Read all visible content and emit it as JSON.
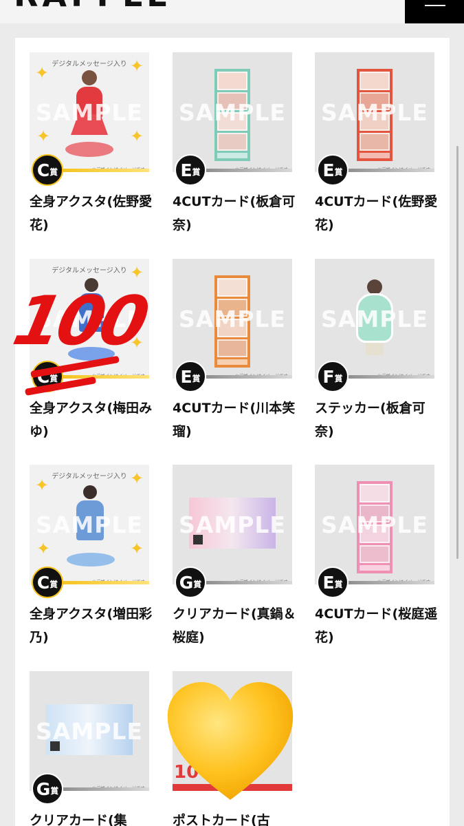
{
  "header": {
    "logo_text": "RAFFLE",
    "menu_icon": "hamburger-icon"
  },
  "products": [
    {
      "title": "全身アクスタ(佐野愛花)",
      "prize_letter": "C",
      "prize_kanji": "賞",
      "type": "stand",
      "tag": "デジタルメッセージ入り",
      "watermark": "SAMPLE",
      "note": "※デザインはイメージです"
    },
    {
      "title": "4CUTカード(板倉可奈)",
      "prize_letter": "E",
      "prize_kanji": "賞",
      "type": "strip",
      "watermark": "SAMPLE",
      "note": "※デザインはイメージです"
    },
    {
      "title": "4CUTカード(佐野愛花)",
      "prize_letter": "E",
      "prize_kanji": "賞",
      "type": "strip",
      "watermark": "SAMPLE",
      "note": "※デザインはイメージです"
    },
    {
      "title": "全身アクスタ(梅田みゆ)",
      "prize_letter": "C",
      "prize_kanji": "賞",
      "type": "stand",
      "tag": "デジタルメッセージ入り",
      "watermark": "SAMPLE",
      "note": "※デザインはイメージです"
    },
    {
      "title": "4CUTカード(川本笑瑠)",
      "prize_letter": "E",
      "prize_kanji": "賞",
      "type": "strip",
      "watermark": "SAMPLE",
      "note": "※デザインはイメージです"
    },
    {
      "title": "ステッカー(板倉可奈)",
      "prize_letter": "F",
      "prize_kanji": "賞",
      "type": "sticker",
      "watermark": "SAMPLE",
      "note": "※デザインはイメージです"
    },
    {
      "title": "全身アクスタ(増田彩乃)",
      "prize_letter": "C",
      "prize_kanji": "賞",
      "type": "stand",
      "tag": "デジタルメッセージ入り",
      "watermark": "SAMPLE",
      "note": "※デザインはイメージです"
    },
    {
      "title": "クリアカード(真鍋＆桜庭)",
      "prize_letter": "G",
      "prize_kanji": "賞",
      "type": "card",
      "watermark": "SAMPLE",
      "note": "※デザインはイメージです"
    },
    {
      "title": "4CUTカード(桜庭遥花)",
      "prize_letter": "E",
      "prize_kanji": "賞",
      "type": "strip",
      "watermark": "SAMPLE",
      "note": "※デザインはイメージです"
    },
    {
      "title": "クリアカード(集",
      "prize_letter": "G",
      "prize_kanji": "賞",
      "type": "card",
      "watermark": "SAMPLE",
      "note": "※デザインはイメージです"
    },
    {
      "title": "ポストカード(古",
      "prize_letter": "",
      "prize_kanji": "",
      "type": "postcard",
      "watermark": "",
      "note": "",
      "partial_label": "10"
    }
  ],
  "overlays": {
    "hundred_emoji": "100",
    "heart_emoji": "yellow-heart"
  },
  "colors": {
    "gold": "#f4c21b",
    "badge": "#111111",
    "red_emoji": "#e31111",
    "heart": "#ffc21f"
  }
}
